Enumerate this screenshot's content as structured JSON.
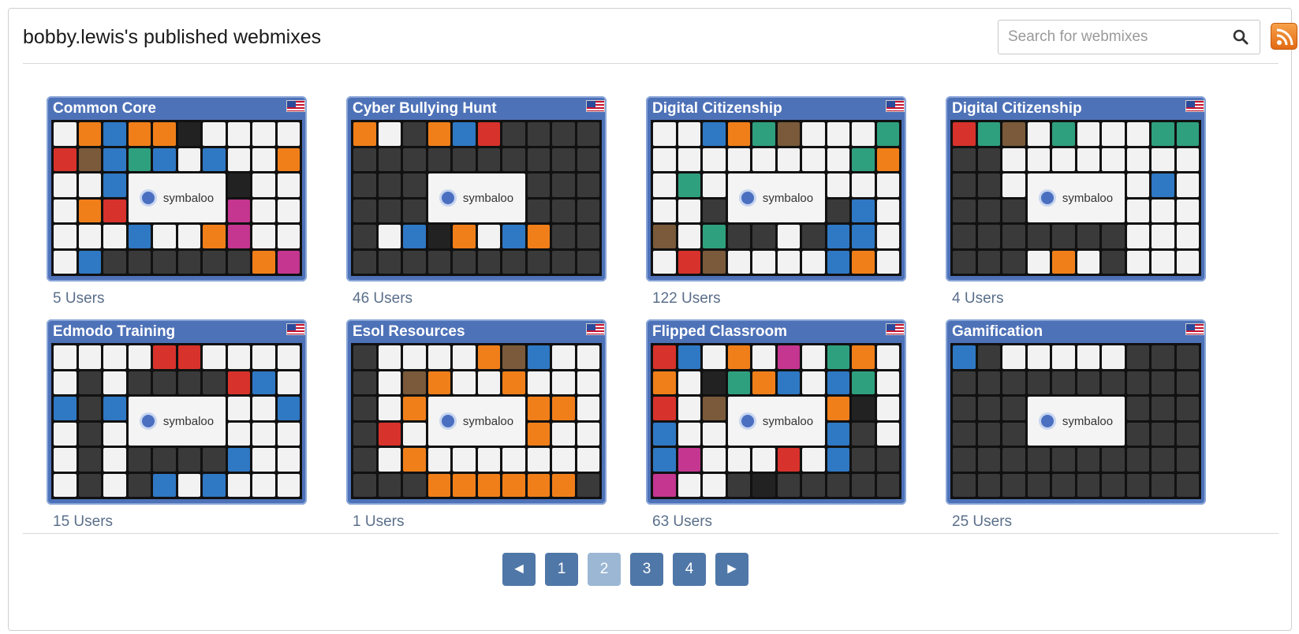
{
  "header": {
    "title": "bobby.lewis's published webmixes",
    "search_placeholder": "Search for webmixes",
    "rss_icon": "rss-feed-icon"
  },
  "webmixes": [
    {
      "title": "Common Core",
      "users": "5 Users"
    },
    {
      "title": "Cyber Bullying Hunt",
      "users": "46 Users"
    },
    {
      "title": "Digital Citizenship",
      "users": "122 Users"
    },
    {
      "title": "Digital Citizenship",
      "users": "4 Users"
    },
    {
      "title": "Edmodo Training",
      "users": "15 Users"
    },
    {
      "title": "Esol Resources",
      "users": "1 Users"
    },
    {
      "title": "Flipped Classroom",
      "users": "63 Users"
    },
    {
      "title": "Gamification",
      "users": "25 Users"
    }
  ],
  "thumbnail": {
    "logo_text": "symbaloo"
  },
  "pagination": {
    "prev": "◄",
    "pages": [
      "1",
      "2",
      "3",
      "4"
    ],
    "current_page": "2",
    "next": "►"
  },
  "colors": {
    "card_blue": "#4e72b8",
    "page_button": "#4f77a7",
    "page_button_current": "#9bb7d4",
    "user_count_text": "#5a6f8a"
  }
}
